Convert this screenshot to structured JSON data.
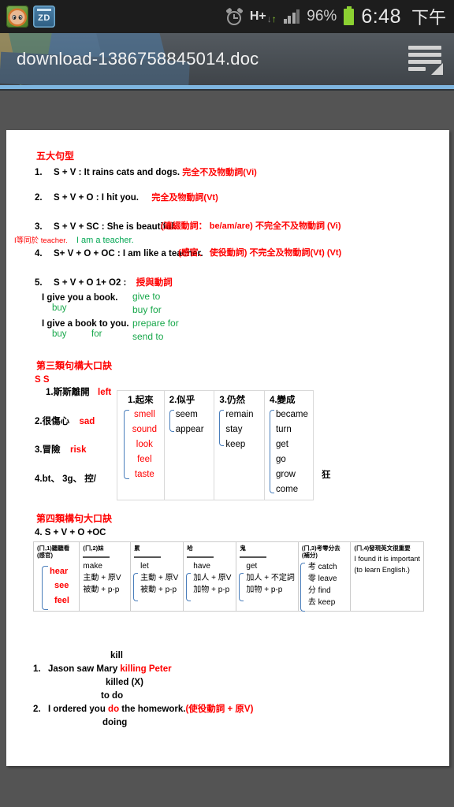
{
  "status_bar": {
    "app_icons": [
      {
        "name": "kenny-app-icon",
        "label": ""
      },
      {
        "name": "zd-app-icon",
        "label": "ZD"
      }
    ],
    "alarm_icon": "alarm-icon",
    "network_type": "H+",
    "signal_icon": "signal-bars-icon",
    "battery_percent": "96%",
    "battery_icon": "battery-icon",
    "time": "6:48",
    "am_pm": "下午"
  },
  "title_bar": {
    "document_name": "download-1386758845014.doc",
    "menu_button": "menu-icon"
  },
  "document": {
    "section1": {
      "heading": "五大句型",
      "items": [
        {
          "num": "1.",
          "text": "S + V :  It rains cats and dogs.",
          "note": "完全不及物動詞(Vi)"
        },
        {
          "num": "2.",
          "text": "S + V + O :  I hit you.",
          "note": "完全及物動詞(Vt)"
        },
        {
          "num": "3.",
          "text": "S + V + SC :  She is beautiful.",
          "note": "(連綴動詞：  be/am/are)",
          "note2": "不完全不及物動詞 (Vi)"
        },
        {
          "num": "4.",
          "text": "S+ V + O + OC :  I am like a teacher.",
          "note": "(感官、 使役動詞) ",
          "note2": "不完全及物動詞(Vt) (Vt)"
        },
        {
          "num": "5.",
          "text": "S + V + O 1+ O2 :",
          "note": "授與動詞"
        }
      ],
      "annotation_red": "I等同於  teacher.",
      "annotation_green": "I am a teacher.",
      "examples": [
        {
          "sentence": "I give you a book.",
          "sub": "buy",
          "sub2": ""
        },
        {
          "sentence": "I give a book to you.",
          "sub": "buy",
          "sub2": "for"
        }
      ],
      "verb_list": [
        "give to",
        "buy for",
        "prepare for",
        "send to"
      ]
    },
    "section2": {
      "heading": "第三類句構大口訣",
      "ss": "S S",
      "mnemonics": [
        {
          "text": "1.斯斯離開",
          "word": "left"
        },
        {
          "text": "2.很傷心",
          "word": "sad"
        },
        {
          "text": "3.冒險",
          "word": "risk"
        },
        {
          "text": "4.bt、 3g、 控/",
          "word": ""
        }
      ],
      "side_note": "狂",
      "table": {
        "columns": [
          {
            "header": "1.起來",
            "items": [
              "smell",
              "sound",
              "look",
              "feel",
              "taste"
            ],
            "color": "#ff0000"
          },
          {
            "header": "2.似乎",
            "items": [
              "seem",
              "appear"
            ],
            "color": "#000000"
          },
          {
            "header": "3.仍然",
            "items": [
              "remain",
              "stay",
              "keep"
            ],
            "color": "#000000"
          },
          {
            "header": "4.變成",
            "items": [
              "became",
              "turn",
              "get",
              "go",
              "grow",
              "come"
            ],
            "color": "#000000"
          }
        ]
      }
    },
    "section3": {
      "heading": "第四類構句大口訣",
      "subheading": "4. S + V + O +OC",
      "table": {
        "cells": [
          {
            "header": "(ㄇ,1)聽聽看(感官)",
            "verb": "",
            "items": [
              "hear",
              "see",
              "feel"
            ],
            "color": "#ff0000",
            "rows": []
          },
          {
            "header": "(ㄇ,2)妹",
            "verb": "make",
            "items": [],
            "color": "#000000",
            "rows": [
              "主動 + 原V",
              "被動 + p-p"
            ]
          },
          {
            "header": "累",
            "verb": "let",
            "items": [],
            "color": "#000000",
            "rows": [
              "主動 + 原V",
              "被動 + p-p"
            ]
          },
          {
            "header": "哈",
            "verb": "have",
            "items": [],
            "color": "#000000",
            "rows": [
              "加人 + 原V",
              "加物 + p-p"
            ]
          },
          {
            "header": "鬼",
            "verb": "get",
            "items": [],
            "color": "#000000",
            "rows": [
              "加人 + 不定詞",
              "加物 + p-p"
            ]
          },
          {
            "header": "(ㄇ,3)考零分去(補分)",
            "verb": "",
            "items": [],
            "color": "#000000",
            "rows": [
              "考  catch",
              "零  leave",
              "分  find",
              "去  keep"
            ]
          },
          {
            "header": "(ㄇ,4)發現英文很重要",
            "verb": "",
            "items": [],
            "color": "#000000",
            "rows": [
              "I found it is important",
              "(to learn English.)"
            ]
          }
        ]
      },
      "examples": [
        {
          "above": "kill",
          "num": "1.",
          "text": "Jason saw Mary ",
          "red": "killing Peter",
          "below1": "killed (X)",
          "below2": ""
        },
        {
          "above": "to do",
          "num": "2.",
          "text": "I ordered you ",
          "red": "do",
          "text2": " the homework.",
          "note": "(使役動詞 + 原V)",
          "below1": "doing"
        }
      ]
    }
  }
}
